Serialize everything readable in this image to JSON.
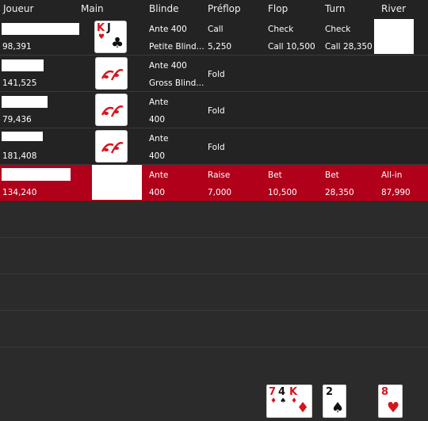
{
  "columns": [
    "Joueur",
    "Main",
    "Blinde",
    "Préflop",
    "Flop",
    "Turn",
    "River"
  ],
  "players": [
    {
      "stack": "98,391",
      "blinde": [
        "Ante 400",
        "Petite Blind..."
      ],
      "preflop": [
        "Call",
        "5,250"
      ],
      "flop": [
        "Check",
        "Call 10,500"
      ],
      "turn": [
        "Check",
        "Call 28,350"
      ],
      "river": [
        "",
        ""
      ],
      "hand": "K J"
    },
    {
      "stack": "141,525",
      "blinde": [
        "Ante 400",
        "Gross Blind..."
      ],
      "preflop": [
        "Fold"
      ],
      "flop": [],
      "turn": [],
      "river": []
    },
    {
      "stack": "79,436",
      "blinde": [
        "Ante",
        "400"
      ],
      "preflop": [
        "Fold"
      ],
      "flop": [],
      "turn": [],
      "river": []
    },
    {
      "stack": "181,408",
      "blinde": [
        "Ante",
        "400"
      ],
      "preflop": [
        "Fold"
      ],
      "flop": [],
      "turn": [],
      "river": []
    },
    {
      "stack": "134,240",
      "blinde": [
        "Ante",
        "400"
      ],
      "preflop": [
        "Raise",
        "7,000"
      ],
      "flop": [
        "Bet",
        "10,500"
      ],
      "turn": [
        "Bet",
        "28,350"
      ],
      "river": [
        "All-in",
        "87,990"
      ]
    }
  ],
  "board": {
    "flop": [
      {
        "rank": "7",
        "color": "red"
      },
      {
        "rank": "4",
        "color": "black"
      },
      {
        "rank": "K",
        "color": "red"
      }
    ],
    "turn": [
      {
        "rank": "2",
        "color": "black"
      }
    ],
    "river": [
      {
        "rank": "8",
        "color": "red"
      }
    ]
  },
  "colors": {
    "background": "#2a2a2a",
    "highlight_row": "#b0001a",
    "card_red": "#d6141e",
    "card_black": "#111111"
  }
}
